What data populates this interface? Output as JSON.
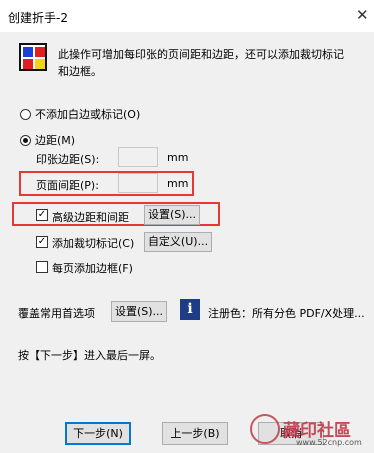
{
  "window": {
    "title": "创建折手-2"
  },
  "intro": {
    "text_line1": "此操作可增加每印张的页间距和边距，还可以添加裁切标记",
    "text_line2": "和边框。"
  },
  "options": {
    "no_margin_label": "不添加白边或标记(O)",
    "margin_label": "边距(M)",
    "sheet_margin_label": "印张边距(S):",
    "sheet_margin_value": "",
    "page_spacing_label": "页面间距(P):",
    "page_spacing_value": "",
    "unit": "mm",
    "advanced_label": "高级边距和间距",
    "advanced_button": "设置(S)...",
    "crop_marks_label": "添加裁切标记(C)",
    "crop_marks_button": "自定义(U)...",
    "border_label": "每页添加边框(F)"
  },
  "preferences": {
    "label": "覆盖常用首选项",
    "button": "设置(S)...",
    "info_text": "注册色：所有分色 PDF/X处理..."
  },
  "instruction": "按【下一步】进入最后一屏。",
  "footer": {
    "next_button": "下一步(N)",
    "back_button": "上一步(B)",
    "cancel_button": "取消"
  },
  "watermark": {
    "text": "藏印社區",
    "url": "www.52cnp.com"
  },
  "state": {
    "no_margin_selected": false,
    "margin_selected": true,
    "advanced_checked": true,
    "crop_marks_checked": true,
    "border_checked": false
  },
  "colors": {
    "highlight_box": "#e53935",
    "default_button_border": "#0078d7"
  }
}
